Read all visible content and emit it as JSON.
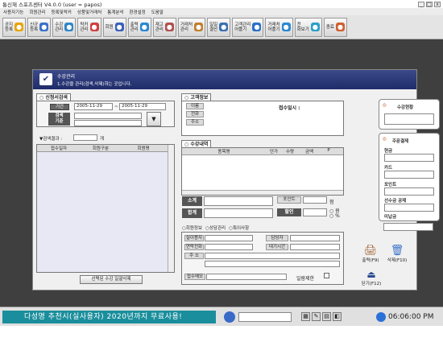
{
  "title_bar": {
    "text": "통신재 스포츠센터 V4.0.0 (user = papos)"
  },
  "menu": [
    "사용자기능",
    "회원관리",
    "등록및락커",
    "상품및거래처",
    "통계분석",
    "환경설정",
    "도움말"
  ],
  "toolbar": [
    {
      "label": "공지\n등록",
      "icon": "lightbulb-icon",
      "color": "#e8a400"
    },
    {
      "label": "신규\n등록",
      "icon": "person-add-icon",
      "color": "#3a70c8"
    },
    {
      "label": "수강\n관리",
      "icon": "monitor-icon",
      "color": "#2f86c8"
    },
    {
      "label": "락커\n관리",
      "icon": "house-icon",
      "color": "#d04040"
    },
    {
      "label": "회원",
      "icon": "people-icon",
      "color": "#3a60b8"
    },
    {
      "label": "출력\n관리",
      "icon": "globe-icon",
      "color": "#2a88d0"
    },
    {
      "label": "재고\n관리",
      "icon": "cart-icon",
      "color": "#b05050"
    },
    {
      "label": "거래처\n관리",
      "icon": "box-icon",
      "color": "#c08030"
    },
    {
      "label": "일일\n결산",
      "icon": "chart-icon",
      "color": "#3a70b0"
    },
    {
      "label": "고객관리\n어플기",
      "icon": "info-icon",
      "color": "#2a70c8"
    },
    {
      "label": "거래처\n어플기",
      "icon": "globe2-icon",
      "color": "#2a88d0"
    },
    {
      "label": "전\n화보기",
      "icon": "phone-icon",
      "color": "#2aa0c8"
    },
    {
      "label": "종료",
      "icon": "exit-icon",
      "color": "#d06030"
    }
  ],
  "window": {
    "title": "수강관리",
    "subtitle": "1.수강을 관리(검색,삭제)하는 곳입니다."
  },
  "search": {
    "section": "신청서검색",
    "period_label": "기간",
    "date_from": "2005-11-29",
    "date_to": "2005-11-29",
    "criteria_label": "검색\n기준",
    "result_label": "▼검색결과 :",
    "result_count": "",
    "result_unit": "개",
    "columns": [
      "접수일자",
      "회원구분",
      "회원명"
    ],
    "bulk_button": "선택된 수강 일괄삭제"
  },
  "customer": {
    "section": "고객정보",
    "fields": [
      "이름",
      "전화",
      "주소"
    ],
    "reception_date_label": "접수일시 :",
    "reception_date": ""
  },
  "course": {
    "section": "수강내역",
    "columns": [
      "종목명",
      "단가",
      "수량",
      "금액",
      "P"
    ],
    "subtotal_label": "소계",
    "total_label": "합계",
    "points_label": "포인트",
    "points_unit": "점",
    "discount_label": "할인",
    "won_label": "원",
    "pct_label": "%"
  },
  "member_tabs": [
    "회원정보",
    "상담관리",
    "특이사항"
  ],
  "member_info": {
    "job_label": "실이용자",
    "contact_label": "연락전화",
    "address_label": "주 소",
    "manager_label": "담당자",
    "wait_label": "대기시간",
    "reception_label": "접수메모",
    "limit_label": "일람제한"
  },
  "status": {
    "title": "수강현황",
    "value": ""
  },
  "payment": {
    "title": "주문결제",
    "cash": "현금",
    "card": "카드",
    "point": "포인트",
    "prepay": "선수금 공제",
    "remaining": "미납금"
  },
  "actions": {
    "print": "출력(F9)",
    "delete": "삭제(F10)",
    "close": "닫기(F12)"
  },
  "taskbar": {
    "message": "다성명 추천시(실사용자) 2020년까지 무료사용!",
    "clock": "06:06:00 PM"
  }
}
